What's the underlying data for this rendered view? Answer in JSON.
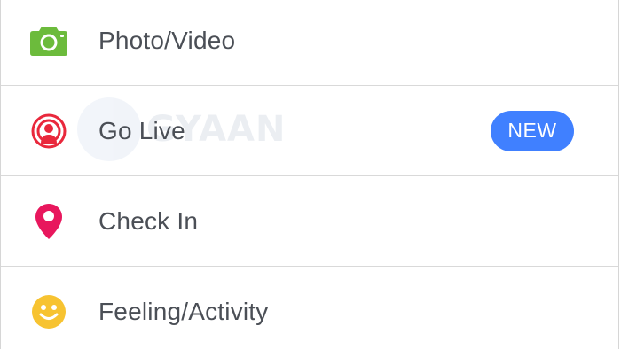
{
  "menu": {
    "items": [
      {
        "label": "Photo/Video",
        "icon": "camera-icon",
        "color": "#6cbb3c"
      },
      {
        "label": "Go Live",
        "icon": "live-broadcast-icon",
        "color": "#e9283c",
        "badge": "NEW"
      },
      {
        "label": "Check In",
        "icon": "location-pin-icon",
        "color": "#e8175d"
      },
      {
        "label": "Feeling/Activity",
        "icon": "smiley-face-icon",
        "color": "#f7c331"
      }
    ]
  },
  "badge_color": "#4080ff",
  "watermark": "GYAAN"
}
